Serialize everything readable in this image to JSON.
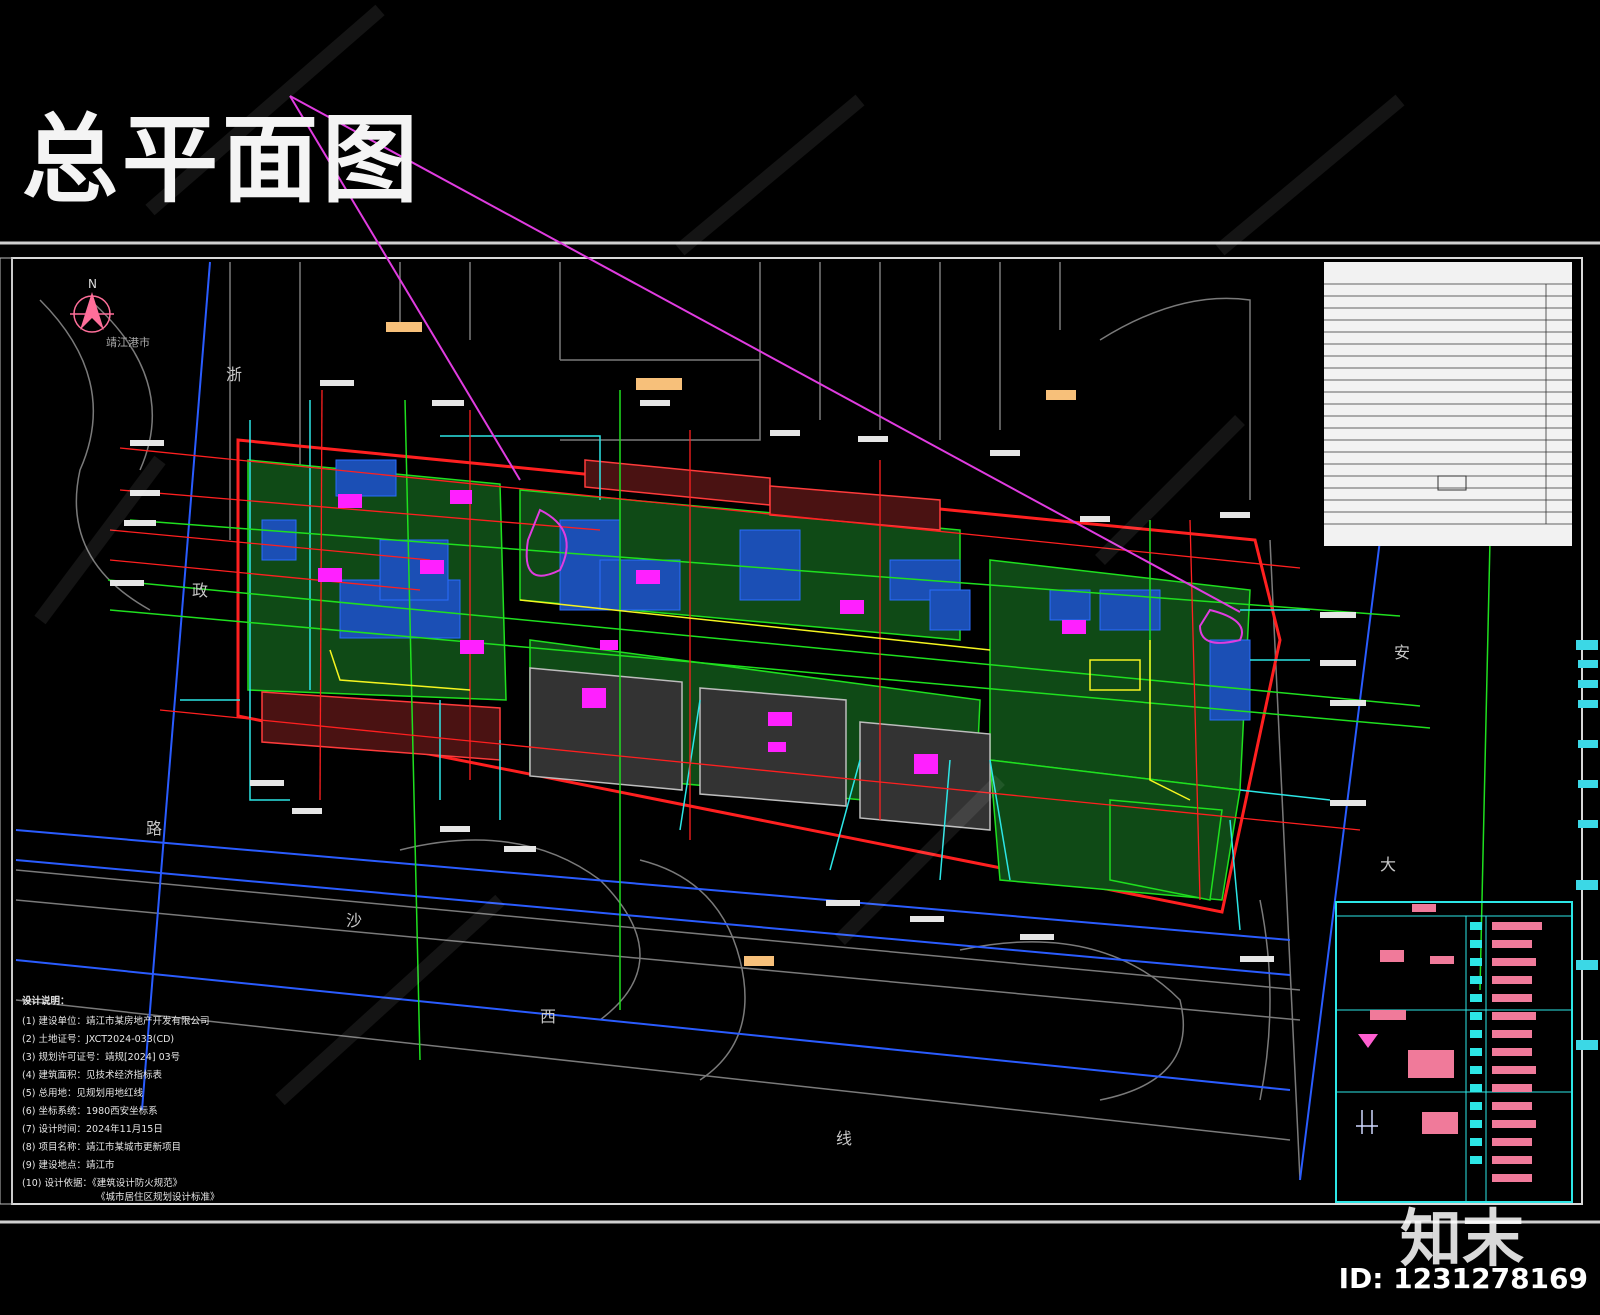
{
  "title": "总平面图",
  "north_label": "N",
  "compass_label": "靖江港市",
  "road_chars": {
    "left_top": "浙",
    "left_mid": "政",
    "left_bottom": "路",
    "bottom_1": "沙",
    "bottom_2": "西",
    "bottom_3": "线",
    "right_1": "安",
    "right_2": "大"
  },
  "notes_heading": "设计说明：",
  "notes": [
    "(1) 建设单位：靖江市某房地产开发有限公司",
    "(2) 土地证号：JXCT2024-033(CD)",
    "(3) 规划许可证号：靖规[2024] 03号",
    "(4) 建筑面积：见技术经济指标表",
    "(5) 总用地：见规划用地红线",
    "(6) 坐标系统：1980西安坐标系",
    "(7) 设计时间：2024年11月15日",
    "(8) 项目名称：靖江市某城市更新项目",
    "(9) 建设地点：靖江市",
    "(10) 设计依据：《建筑设计防火规范》",
    "《城市居住区规划设计标准》"
  ],
  "watermark_logo": "知末",
  "watermark_id": "ID: 1231278169",
  "colors": {
    "background": "#000000",
    "red_line": "#ff2020",
    "green": "#1fe01f",
    "cyan": "#2ce6e6",
    "magenta": "#ff20ff",
    "blue": "#1a5cff",
    "yellow": "#f5f520",
    "salmon": "#f7c07a",
    "pink": "#ff6f9a",
    "gray": "#8a8a8a"
  }
}
